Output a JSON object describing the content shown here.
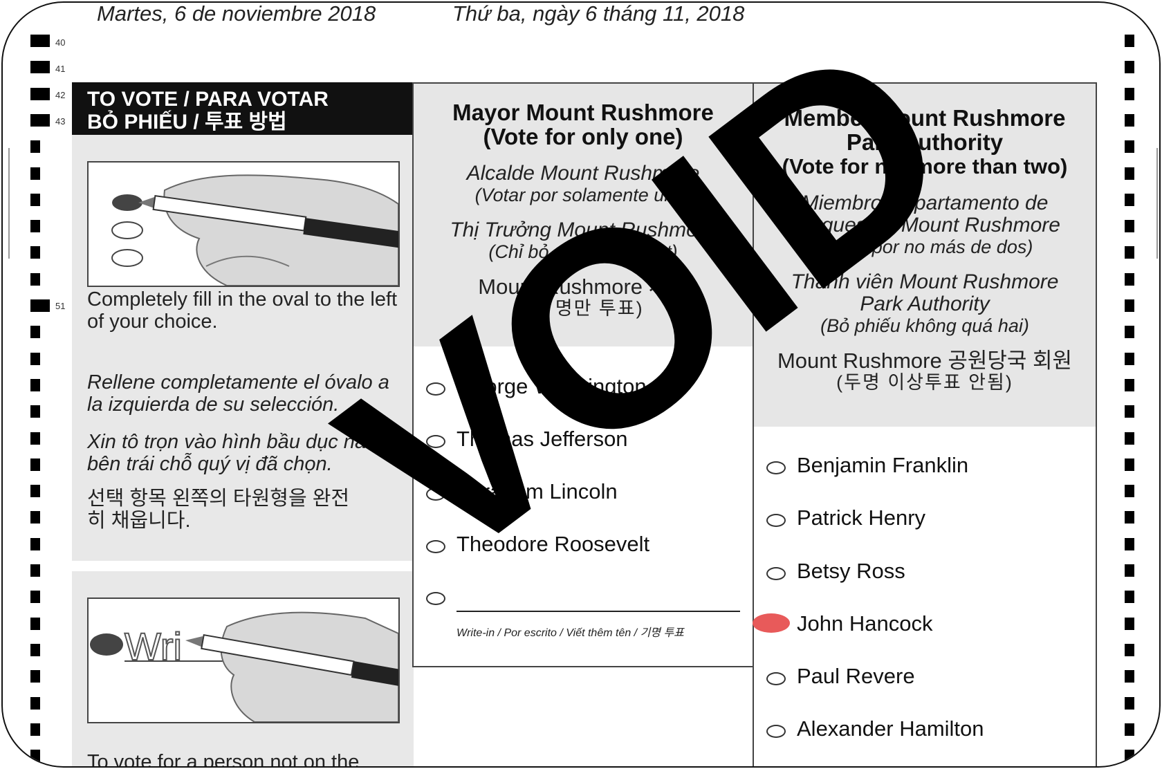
{
  "dates": {
    "spanish": "Martes, 6 de noviembre 2018",
    "vietnamese": "Thứ ba, ngày 6 tháng 11, 2018"
  },
  "row_numbers": [
    "40",
    "41",
    "42",
    "43",
    "51"
  ],
  "instructions": {
    "header_line1": "TO VOTE / PARA VOTAR",
    "header_line2": "BỎ PHIẾU / 투표 방법",
    "english": "Completely fill in the oval to the left of your choice.",
    "spanish": "Rellene completamente el óvalo a la izquierda de su selección.",
    "vietnamese": "Xin tô trọn vào hình bầu dục nằm bên trái chỗ quý vị đã chọn.",
    "korean": "선택 항목 왼쪽의 타원형을 완전히 채웁니다.",
    "writein_illustration_text": "Wri",
    "writein_instruction": "To vote for a person not on the"
  },
  "contest_mayor": {
    "title": "Mayor Mount Rushmore",
    "subtitle": "(Vote for only one)",
    "es_title": "Alcalde Mount Rushmore",
    "es_sub": "(Votar por solamente uno)",
    "vi_title": "Thị Trưởng Mount Rushmore",
    "vi_sub": "(Chỉ bỏ phiếu cho một)",
    "ko_title": "Mount Rushmore 시장",
    "ko_sub": "(한 명만 투표)",
    "candidates": [
      "George Washington",
      "Thomas Jefferson",
      "Abraham Lincoln",
      "Theodore Roosevelt"
    ],
    "writein_label": "Write-in / Por escrito / Viết thêm tên / 기명 투표"
  },
  "contest_park": {
    "title_line1": "Member Mount Rushmore",
    "title_line2": "Park Authority",
    "subtitle": "(Vote for not more than two)",
    "es_line1": "Miembro Departamento de",
    "es_line2": "Parques de Mount Rushmore",
    "es_sub": "(Votar por no más de dos)",
    "vi_line1": "Thành viên Mount Rushmore",
    "vi_line2": "Park Authority",
    "vi_sub": "(Bỏ phiếu không quá hai)",
    "ko_title": "Mount Rushmore 공원당국 회원",
    "ko_sub": "(두명 이상투표 안됨)",
    "candidates": [
      "Benjamin Franklin",
      "Patrick Henry",
      "Betsy Ross",
      "John Hancock",
      "Paul Revere",
      "Alexander Hamilton"
    ],
    "marked_candidate": "John Hancock",
    "mark_color": "#e85a5a"
  },
  "watermark": "VOID"
}
